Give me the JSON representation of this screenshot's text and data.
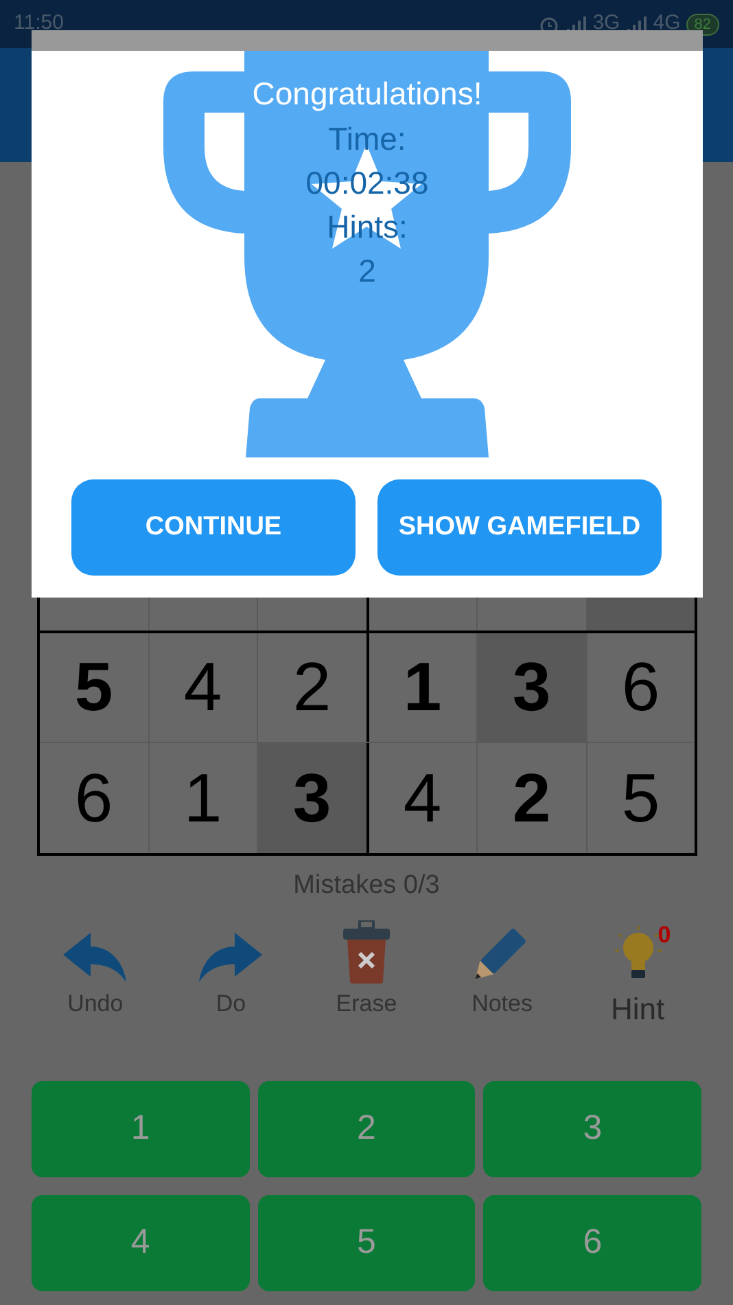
{
  "status_bar": {
    "time": "11:50",
    "network_1": "3G",
    "network_2": "4G",
    "battery": "82"
  },
  "dialog": {
    "title": "Congratulations!",
    "time_label": "Time:",
    "time": "00:02:38",
    "hints_label": "Hints:",
    "hints": "2",
    "buttons": [
      "CONTINUE",
      "SHOW GAMEFIELD"
    ]
  },
  "grid": {
    "rows": [
      [
        {
          "highlighted": false
        },
        {
          "highlighted": false
        },
        {
          "highlighted": false
        },
        {
          "highlighted": false
        },
        {
          "highlighted": false
        },
        {
          "highlighted": true
        }
      ],
      [
        {
          "value": "5",
          "given": true,
          "highlighted": false
        },
        {
          "value": "4",
          "given": false,
          "highlighted": false
        },
        {
          "value": "2",
          "given": false,
          "highlighted": false
        },
        {
          "value": "1",
          "given": true,
          "highlighted": false
        },
        {
          "value": "3",
          "given": true,
          "highlighted": true
        },
        {
          "value": "6",
          "given": false,
          "highlighted": false
        }
      ],
      [
        {
          "value": "6",
          "given": false,
          "highlighted": false
        },
        {
          "value": "1",
          "given": false,
          "highlighted": false
        },
        {
          "value": "3",
          "given": true,
          "highlighted": true
        },
        {
          "value": "4",
          "given": false,
          "highlighted": false
        },
        {
          "value": "2",
          "given": true,
          "highlighted": false
        },
        {
          "value": "5",
          "given": false,
          "highlighted": false
        }
      ]
    ]
  },
  "mistakes": "Mistakes 0/3",
  "tools": [
    {
      "kind": "undo",
      "label": "Undo"
    },
    {
      "kind": "redo",
      "label": "Do"
    },
    {
      "kind": "erase",
      "label": "Erase"
    },
    {
      "kind": "notes",
      "label": "Notes"
    },
    {
      "kind": "hint",
      "label": "Hint",
      "badge": "0"
    }
  ],
  "numbers": [
    "1",
    "2",
    "3",
    "4",
    "5",
    "6"
  ]
}
